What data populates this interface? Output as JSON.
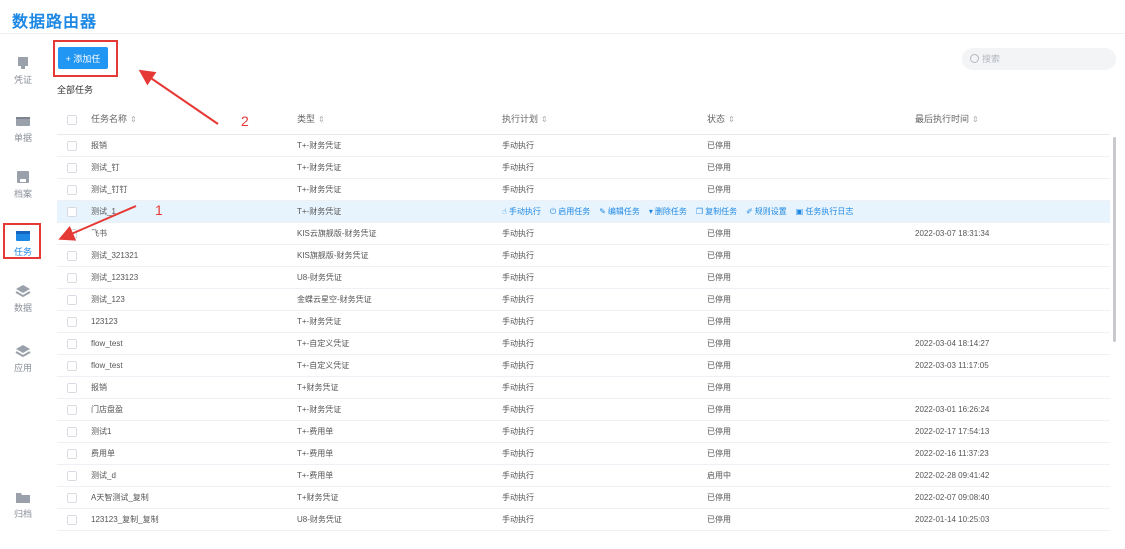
{
  "app": {
    "title": "数据路由器"
  },
  "sidebar": {
    "items": [
      {
        "label": "凭证",
        "icon": "voucher-icon"
      },
      {
        "label": "单据",
        "icon": "document-icon"
      },
      {
        "label": "档案",
        "icon": "archive-icon"
      },
      {
        "label": "任务",
        "icon": "task-icon",
        "active": true
      },
      {
        "label": "数据",
        "icon": "data-layers-icon"
      },
      {
        "label": "应用",
        "icon": "app-layers-icon"
      },
      {
        "label": "归档",
        "icon": "folder-icon"
      }
    ]
  },
  "toolbar": {
    "add_label": "+ 添加任务",
    "section_label": "全部任务",
    "search_placeholder": "搜索"
  },
  "table": {
    "headers": [
      "任务名称",
      "类型",
      "执行计划",
      "状态",
      "最后执行时间"
    ],
    "rows": [
      {
        "name": "报销",
        "type": "T+-财务凭证",
        "plan": "手动执行",
        "status": "已停用",
        "time": ""
      },
      {
        "name": "测试_钉",
        "type": "T+-财务凭证",
        "plan": "手动执行",
        "status": "已停用",
        "time": ""
      },
      {
        "name": "测试_钉钉",
        "type": "T+-财务凭证",
        "plan": "手动执行",
        "status": "已停用",
        "time": ""
      },
      {
        "name": "测试_1",
        "type": "T+-财务凭证",
        "plan": "",
        "status": "",
        "time": "",
        "hover": true
      },
      {
        "name": "飞书",
        "type": "KIS云旗舰版-财务凭证",
        "plan": "手动执行",
        "status": "已停用",
        "time": "2022-03-07 18:31:34"
      },
      {
        "name": "测试_321321",
        "type": "KIS旗舰版-财务凭证",
        "plan": "手动执行",
        "status": "已停用",
        "time": ""
      },
      {
        "name": "测试_123123",
        "type": "U8-财务凭证",
        "plan": "手动执行",
        "status": "已停用",
        "time": ""
      },
      {
        "name": "测试_123",
        "type": "金蝶云星空-财务凭证",
        "plan": "手动执行",
        "status": "已停用",
        "time": ""
      },
      {
        "name": "123123",
        "type": "T+-财务凭证",
        "plan": "手动执行",
        "status": "已停用",
        "time": ""
      },
      {
        "name": "flow_test",
        "type": "T+-自定义凭证",
        "plan": "手动执行",
        "status": "已停用",
        "time": "2022-03-04 18:14:27"
      },
      {
        "name": "flow_test",
        "type": "T+-自定义凭证",
        "plan": "手动执行",
        "status": "已停用",
        "time": "2022-03-03 11:17:05"
      },
      {
        "name": "报销",
        "type": "T+财务凭证",
        "plan": "手动执行",
        "status": "已停用",
        "time": ""
      },
      {
        "name": "门店盘盈",
        "type": "T+-财务凭证",
        "plan": "手动执行",
        "status": "已停用",
        "time": "2022-03-01 16:26:24"
      },
      {
        "name": "测试1",
        "type": "T+-费用单",
        "plan": "手动执行",
        "status": "已停用",
        "time": "2022-02-17 17:54:13"
      },
      {
        "name": "费用单",
        "type": "T+-费用单",
        "plan": "手动执行",
        "status": "已停用",
        "time": "2022-02-16 11:37:23"
      },
      {
        "name": "测试_d",
        "type": "T+-费用单",
        "plan": "手动执行",
        "status": "启用中",
        "time": "2022-02-28 09:41:42"
      },
      {
        "name": "A天智测试_复制",
        "type": "T+财务凭证",
        "plan": "手动执行",
        "status": "已停用",
        "time": "2022-02-07 09:08:40"
      },
      {
        "name": "123123_复制_复制",
        "type": "U8-财务凭证",
        "plan": "手动执行",
        "status": "已停用",
        "time": "2022-01-14 10:25:03"
      }
    ],
    "row_actions": [
      {
        "label": "手动执行",
        "icon": "hand-pointer-icon",
        "glyph": "☝"
      },
      {
        "label": "启用任务",
        "icon": "power-icon",
        "glyph": "⏻"
      },
      {
        "label": "编辑任务",
        "icon": "edit-icon",
        "glyph": "✎"
      },
      {
        "label": "删除任务",
        "icon": "trash-icon",
        "glyph": "▾"
      },
      {
        "label": "复制任务",
        "icon": "copy-icon",
        "glyph": "❐"
      },
      {
        "label": "规则设置",
        "icon": "wrench-icon",
        "glyph": "✐"
      },
      {
        "label": "任务执行日志",
        "icon": "log-icon",
        "glyph": "▣"
      }
    ]
  },
  "annotations": {
    "step1": "1",
    "step2": "2",
    "color": "#e53935"
  },
  "colors": {
    "accent": "#2196f3",
    "title": "#1e88e5",
    "row_highlight": "#e8f4fd"
  }
}
